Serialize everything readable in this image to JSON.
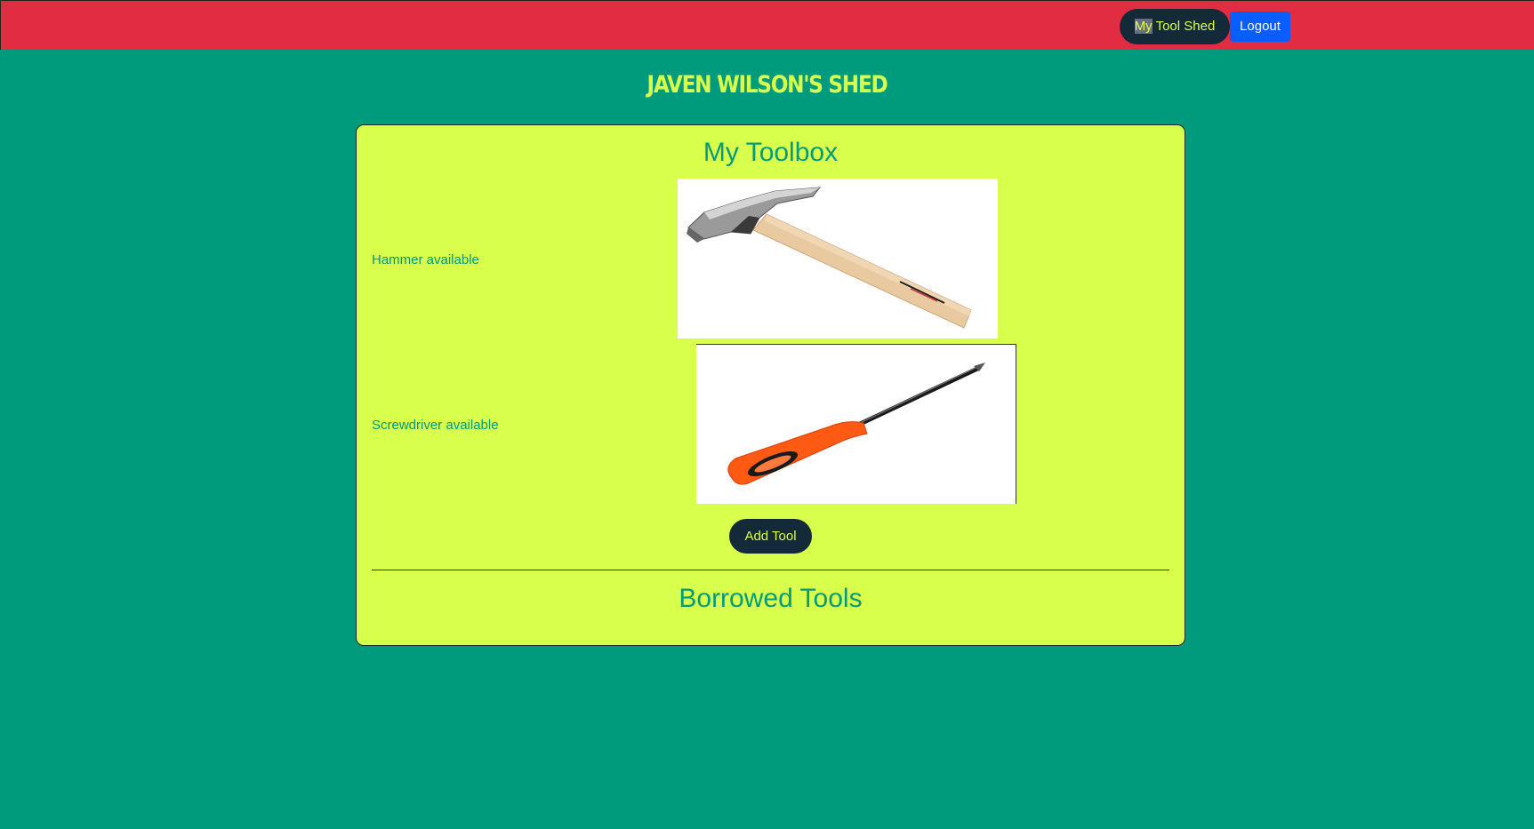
{
  "nav": {
    "shed_highlight": "My",
    "shed_rest": " Tool Shed",
    "logout_label": "Logout"
  },
  "page": {
    "title": "Javen Wilson's Shed"
  },
  "toolbox": {
    "title": "My Toolbox",
    "tools": [
      {
        "label": "Hammer available",
        "image": "hammer-image"
      },
      {
        "label": "Screwdriver available",
        "image": "screwdriver-image"
      }
    ],
    "add_label": "Add Tool"
  },
  "borrowed": {
    "title": "Borrowed Tools"
  },
  "colors": {
    "background": "#009b7d",
    "topbar": "#e22c42",
    "card": "#d8ff4b",
    "accent_text": "#009b7d",
    "dark_button": "#142a39",
    "logout_button": "#0a5dff",
    "title_yellow": "#d7ff4b"
  }
}
